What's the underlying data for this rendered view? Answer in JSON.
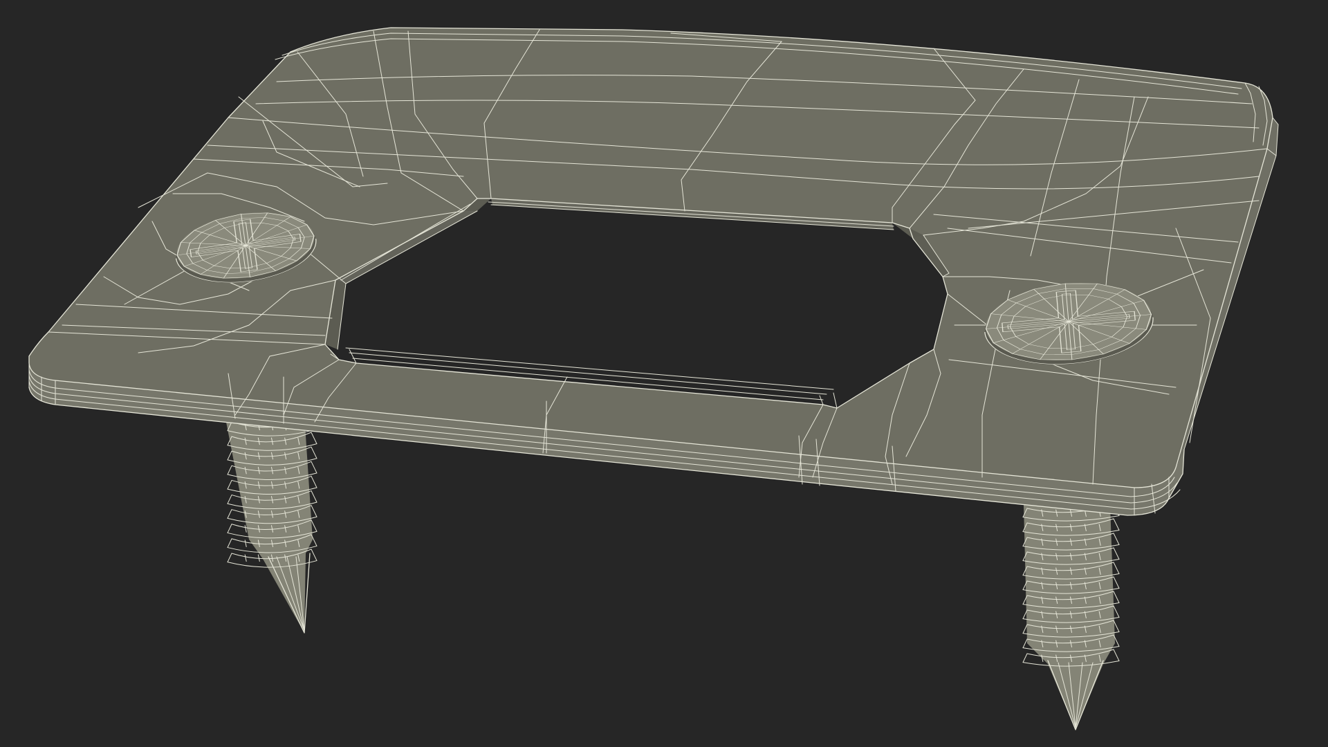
{
  "scene": {
    "background_color": "#262626",
    "surface_top_color": "#6e6e62",
    "surface_edge_color": "#76766a",
    "inner_wall_color": "#5e5e54",
    "screw_color": "#8a8a7c",
    "screw_shadow_color": "#5a5a50",
    "wire_color": "#e6e6d8",
    "objects": [
      {
        "name": "wall-plate-frame",
        "shape": "rounded rectangle with octagonal cut-out",
        "render_mode": "wireframe-over-shaded"
      },
      {
        "name": "screw-left",
        "head": "phillips",
        "render_mode": "wireframe-over-shaded"
      },
      {
        "name": "screw-right",
        "head": "phillips",
        "render_mode": "wireframe-over-shaded"
      }
    ]
  }
}
